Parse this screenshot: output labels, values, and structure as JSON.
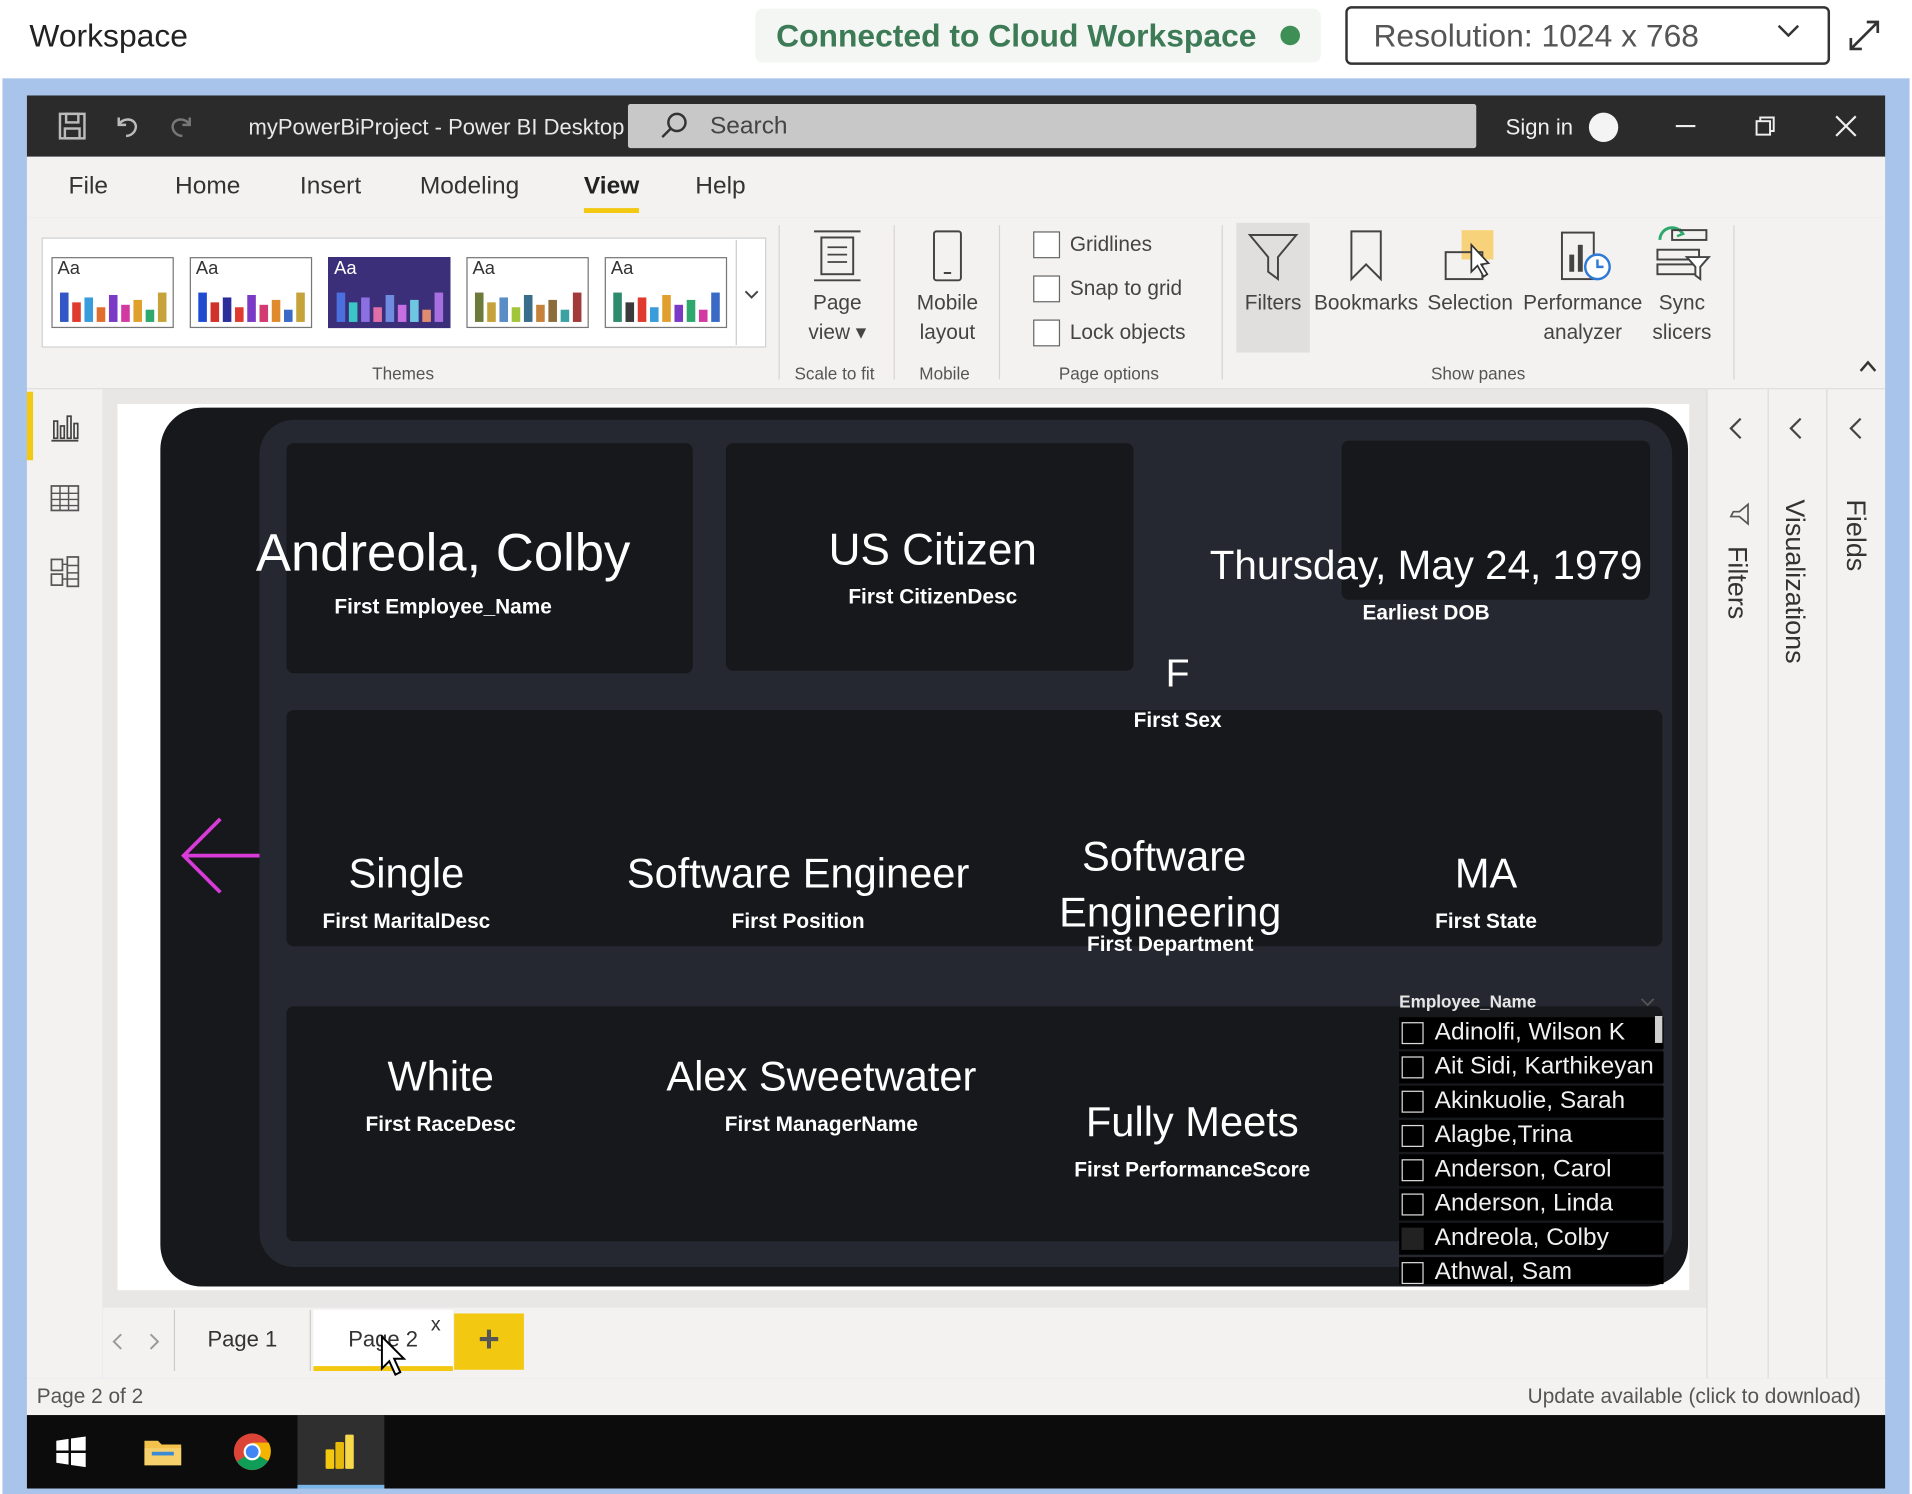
{
  "workspace": {
    "title": "Workspace",
    "status": "Connected to Cloud Workspace",
    "status_color": "#3d8f55",
    "resolution": "Resolution:  1024 x 768"
  },
  "app": {
    "title": "myPowerBiProject - Power BI Desktop",
    "search_placeholder": "Search",
    "sign_in": "Sign in"
  },
  "menu": [
    "File",
    "Home",
    "Insert",
    "Modeling",
    "View",
    "Help"
  ],
  "menu_active": "View",
  "ribbon": {
    "themes_label": "Themes",
    "theme_aa": "Aa",
    "scale": {
      "line1": "Page",
      "line2": "view ▾",
      "group": "Scale to fit"
    },
    "mobile": {
      "line1": "Mobile",
      "line2": "layout",
      "group": "Mobile"
    },
    "page_options": {
      "gridlines": "Gridlines",
      "snap": "Snap to grid",
      "lock": "Lock objects",
      "group": "Page options"
    },
    "panes": {
      "filters": "Filters",
      "bookmarks": "Bookmarks",
      "selection": "Selection",
      "performance_1": "Performance",
      "performance_2": "analyzer",
      "sync_1": "Sync",
      "sync_2": "slicers",
      "group": "Show panes"
    }
  },
  "report": {
    "employee_name": {
      "value": "Andreola, Colby",
      "caption": "First Employee_Name"
    },
    "citizen": {
      "value": "US Citizen",
      "caption": "First CitizenDesc"
    },
    "dob": {
      "value": "Thursday, May 24, 1979",
      "caption": "Earliest DOB"
    },
    "sex": {
      "value": "F",
      "caption": "First Sex"
    },
    "marital": {
      "value": "Single",
      "caption": "First MaritalDesc"
    },
    "position": {
      "value": "Software Engineer",
      "caption": "First Position"
    },
    "department": {
      "value_1": "Software",
      "value_2": "Engineering",
      "caption": "First Department"
    },
    "state": {
      "value": "MA",
      "caption": "First State"
    },
    "race": {
      "value": "White",
      "caption": "First RaceDesc"
    },
    "manager": {
      "value": "Alex Sweetwater",
      "caption": "First ManagerName"
    },
    "performance": {
      "value": "Fully Meets",
      "caption": "First PerformanceScore"
    }
  },
  "slicer": {
    "header": "Employee_Name",
    "items": [
      {
        "name": "Adinolfi, Wilson K",
        "checked": false
      },
      {
        "name": "Ait Sidi, Karthikeyan",
        "checked": false
      },
      {
        "name": "Akinkuolie, Sarah",
        "checked": false
      },
      {
        "name": "Alagbe,Trina",
        "checked": false
      },
      {
        "name": "Anderson, Carol",
        "checked": false
      },
      {
        "name": "Anderson, Linda",
        "checked": false
      },
      {
        "name": "Andreola, Colby",
        "checked": true
      },
      {
        "name": "Athwal, Sam",
        "checked": false
      }
    ]
  },
  "panes": {
    "filters": "Filters",
    "visualizations": "Visualizations",
    "fields": "Fields"
  },
  "tabs": {
    "page1": "Page 1",
    "page2": "Page 2",
    "close": "x",
    "add": "+"
  },
  "status": {
    "left": "Page 2 of 2",
    "right": "Update available (click to download)"
  },
  "colors": {
    "accent": "#f2c811",
    "report_bg": "#17181b",
    "arrow": "#d93bd9",
    "titlebar": "#2b2b2b"
  }
}
